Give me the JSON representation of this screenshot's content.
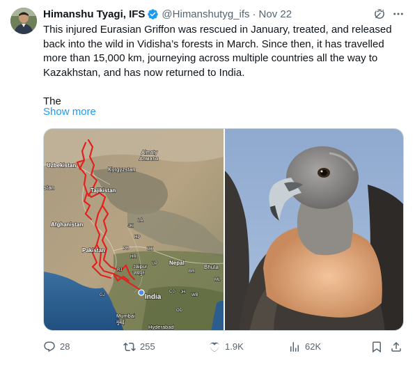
{
  "author": {
    "name": "Himanshu Tyagi, IFS",
    "handle": "@Himanshutyg_ifs",
    "separator": "·",
    "date": "Nov 22"
  },
  "tweet": {
    "text": "This injured Eurasian Griffon was rescued in January, treated, and released back into the wild in Vidisha’s forests in March. Since then, it has travelled more than 15,000 km, journeying across multiple countries all the way to Kazakhstan, and has now returned to India.\n\nThe",
    "show_more": "Show more"
  },
  "map": {
    "labels": {
      "uzbekistan": "Uzbekistan",
      "kyrgyzstan": "Kyrgyzstan",
      "almaty": "Almaty",
      "almaty_local": "Алматы",
      "stan": "stan",
      "tajikistan": "Tajikistan",
      "afghanistan": "Afghanistan",
      "la": "LA",
      "jk": "JK",
      "hp": "HP",
      "pakistan": "Pakistan",
      "pb": "PB",
      "uk": "UK",
      "hr": "HR",
      "nepal": "Nepal",
      "bhutan": "Bhuta",
      "rj": "RJ",
      "jaipur": "Jaipur",
      "jaipur_local": "जयपुर",
      "up": "UP",
      "br": "BR",
      "ml": "ML",
      "gj": "GJ",
      "india": "India",
      "cg": "CG",
      "jh": "JH",
      "wb": "WB",
      "od": "OD",
      "mumbai": "Mumbai",
      "mumbai_local": "मुंबई",
      "hyderabad": "Hyderabad"
    }
  },
  "actions": {
    "replies": "28",
    "reposts": "255",
    "likes": "1.9K",
    "views": "62K"
  },
  "colors": {
    "accent": "#1d9bf0",
    "muted": "#536471",
    "route": "#e3201b"
  }
}
